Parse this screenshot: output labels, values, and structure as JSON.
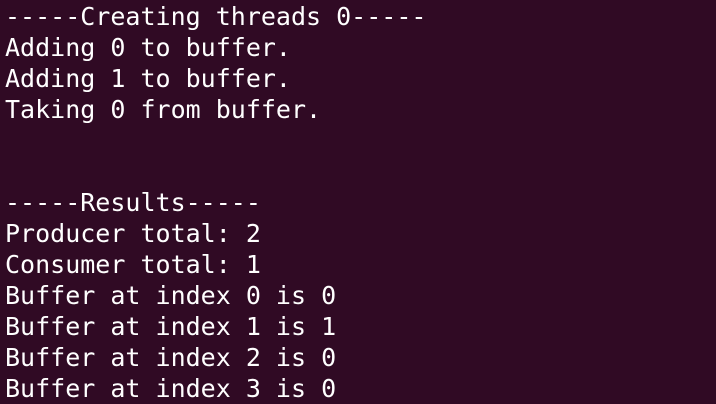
{
  "terminal": {
    "background": "#300a24",
    "foreground": "#ffffff",
    "lines": [
      "-----Creating threads 0-----",
      "Adding 0 to buffer.",
      "Adding 1 to buffer.",
      "Taking 0 from buffer.",
      "",
      "",
      "-----Results-----",
      "Producer total: 2",
      "Consumer total: 1",
      "Buffer at index 0 is 0",
      "Buffer at index 1 is 1",
      "Buffer at index 2 is 0",
      "Buffer at index 3 is 0"
    ]
  }
}
